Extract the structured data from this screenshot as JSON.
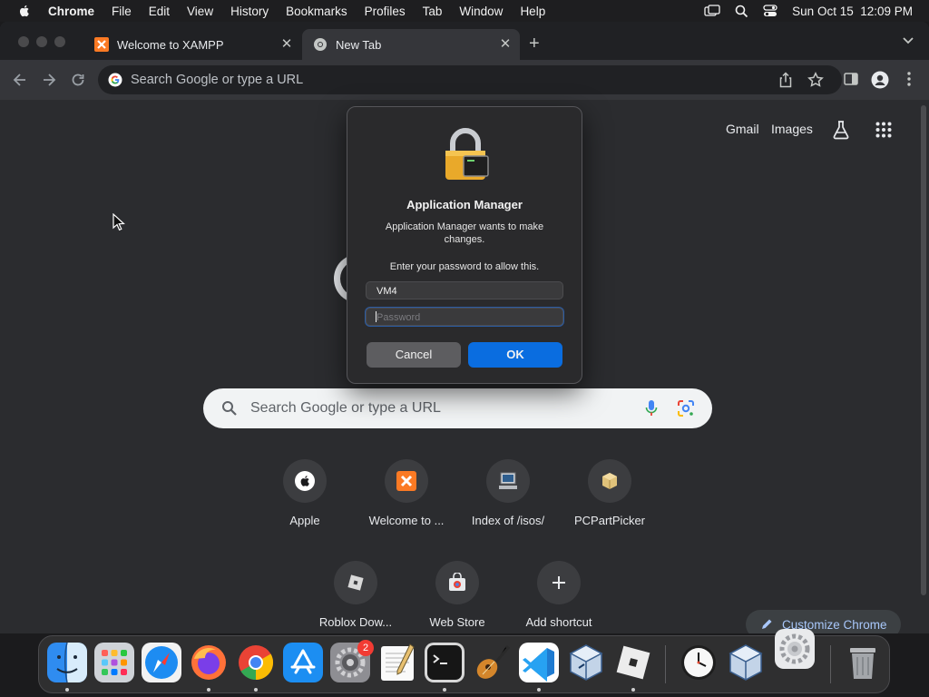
{
  "menubar": {
    "app_name": "Chrome",
    "items": [
      "File",
      "Edit",
      "View",
      "History",
      "Bookmarks",
      "Profiles",
      "Tab",
      "Window",
      "Help"
    ],
    "datetime": "Sun Oct 15  12:09 PM"
  },
  "tabs": [
    {
      "title": "Welcome to XAMPP",
      "favicon": "xampp-icon",
      "active": false
    },
    {
      "title": "New Tab",
      "favicon": "chrome-icon",
      "active": true
    }
  ],
  "omnibox": {
    "placeholder": "Search Google or type a URL"
  },
  "ntp": {
    "links": {
      "gmail": "Gmail",
      "images": "Images"
    },
    "search_placeholder": "Search Google or type a URL",
    "shortcuts": [
      {
        "label": "Apple",
        "icon": "apple-icon"
      },
      {
        "label": "Welcome to ...",
        "icon": "xampp-icon"
      },
      {
        "label": "Index of /isos/",
        "icon": "computer-icon"
      },
      {
        "label": "PCPartPicker",
        "icon": "box-icon"
      },
      {
        "label": "Roblox Dow...",
        "icon": "roblox-icon"
      },
      {
        "label": "Web Store",
        "icon": "web-store-icon"
      },
      {
        "label": "Add shortcut",
        "icon": "plus-icon"
      }
    ],
    "customize_label": "Customize Chrome"
  },
  "dialog": {
    "title": "Application Manager",
    "message": "Application Manager wants to make changes.",
    "prompt": "Enter your password to allow this.",
    "username": "VM4",
    "password_placeholder": "Password",
    "cancel_label": "Cancel",
    "ok_label": "OK"
  },
  "dock": {
    "apps": [
      "Finder",
      "Launchpad",
      "Safari",
      "Firefox",
      "Google Chrome",
      "App Store",
      "System Settings",
      "TextEdit",
      "Terminal",
      "Instruments",
      "Visual Studio Code",
      "VirtualBox",
      "Roblox",
      "Clock",
      "VirtualBox VM",
      "System Preferences",
      "Trash"
    ],
    "settings_badge": "2"
  },
  "colors": {
    "accent": "#0a6de0",
    "ntp_background": "#2b2c2f",
    "dialog_background": "#2a2a2c"
  }
}
